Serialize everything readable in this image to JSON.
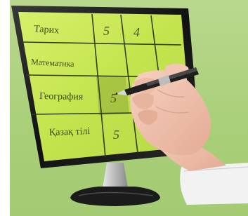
{
  "table": {
    "rows": [
      {
        "subject": "Тарих",
        "grades": [
          "5",
          "4",
          ""
        ]
      },
      {
        "subject": "Математика",
        "grades": [
          "",
          "",
          ""
        ]
      },
      {
        "subject": "География",
        "grades": [
          "5",
          "",
          ""
        ]
      },
      {
        "subject": "Қазақ тілі",
        "grades": [
          "5",
          "",
          ""
        ]
      }
    ]
  },
  "colors": {
    "background": "#a9cf79",
    "screen_green": "#c8e85a",
    "bezel": "#1c1c1c"
  }
}
